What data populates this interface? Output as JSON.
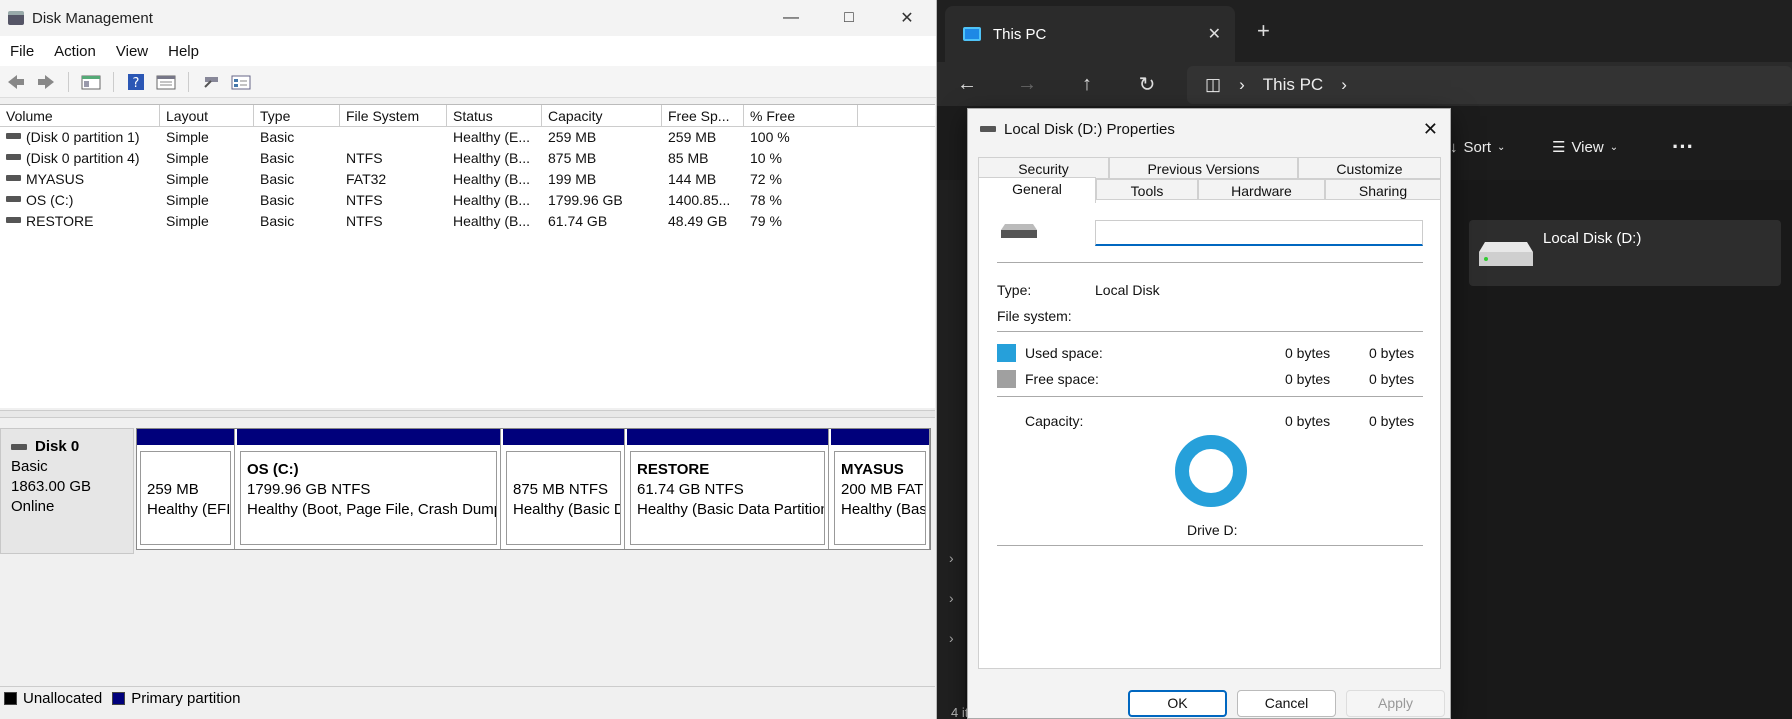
{
  "disk_mgmt": {
    "title": "Disk Management",
    "menu": [
      "File",
      "Action",
      "View",
      "Help"
    ],
    "columns": [
      "Volume",
      "Layout",
      "Type",
      "File System",
      "Status",
      "Capacity",
      "Free Sp...",
      "% Free"
    ],
    "rows": [
      [
        "(Disk 0 partition 1)",
        "Simple",
        "Basic",
        "",
        "Healthy (E...",
        "259 MB",
        "259 MB",
        "100 %"
      ],
      [
        "(Disk 0 partition 4)",
        "Simple",
        "Basic",
        "NTFS",
        "Healthy (B...",
        "875 MB",
        "85 MB",
        "10 %"
      ],
      [
        "MYASUS",
        "Simple",
        "Basic",
        "FAT32",
        "Healthy (B...",
        "199 MB",
        "144 MB",
        "72 %"
      ],
      [
        "OS (C:)",
        "Simple",
        "Basic",
        "NTFS",
        "Healthy (B...",
        "1799.96 GB",
        "1400.85...",
        "78 %"
      ],
      [
        "RESTORE",
        "Simple",
        "Basic",
        "NTFS",
        "Healthy (B...",
        "61.74 GB",
        "48.49 GB",
        "79 %"
      ]
    ],
    "disk": {
      "name": "Disk 0",
      "type": "Basic",
      "size": "1863.00 GB",
      "state": "Online"
    },
    "partitions": [
      {
        "name": "",
        "line1": "259 MB",
        "line2": "Healthy (EFI"
      },
      {
        "name": "OS  (C:)",
        "line1": "1799.96 GB NTFS",
        "line2": "Healthy (Boot, Page File, Crash Dump"
      },
      {
        "name": "",
        "line1": "875 MB NTFS",
        "line2": "Healthy (Basic D"
      },
      {
        "name": "RESTORE",
        "line1": "61.74 GB NTFS",
        "line2": "Healthy (Basic Data Partition"
      },
      {
        "name": "MYASUS",
        "line1": "200 MB FAT",
        "line2": "Healthy (Bas"
      }
    ],
    "legend": {
      "unallocated": "Unallocated",
      "primary": "Primary partition"
    },
    "colors": {
      "primary": "#00007b",
      "unallocated": "#000000"
    }
  },
  "explorer": {
    "tab_title": "This PC",
    "address": "This PC",
    "sort_label": "Sort",
    "view_label": "View",
    "drive_label": "Local Disk (D:)",
    "status_text": "4 it"
  },
  "dialog": {
    "title": "Local Disk (D:) Properties",
    "tabs_row1": [
      "Security",
      "Previous Versions",
      "Customize"
    ],
    "tabs_row2": [
      "General",
      "Tools",
      "Hardware",
      "Sharing"
    ],
    "volume_name": "",
    "type_label": "Type:",
    "type_value": "Local Disk",
    "fs_label": "File system:",
    "used_label": "Used space:",
    "used_bytes": "0 bytes",
    "used_size": "0 bytes",
    "free_label": "Free space:",
    "free_bytes": "0 bytes",
    "free_size": "0 bytes",
    "cap_label": "Capacity:",
    "cap_bytes": "0 bytes",
    "cap_size": "0 bytes",
    "drive_caption": "Drive D:",
    "ok": "OK",
    "cancel": "Cancel",
    "apply": "Apply",
    "colors": {
      "used": "#26a0da",
      "free": "#a0a0a0"
    }
  }
}
